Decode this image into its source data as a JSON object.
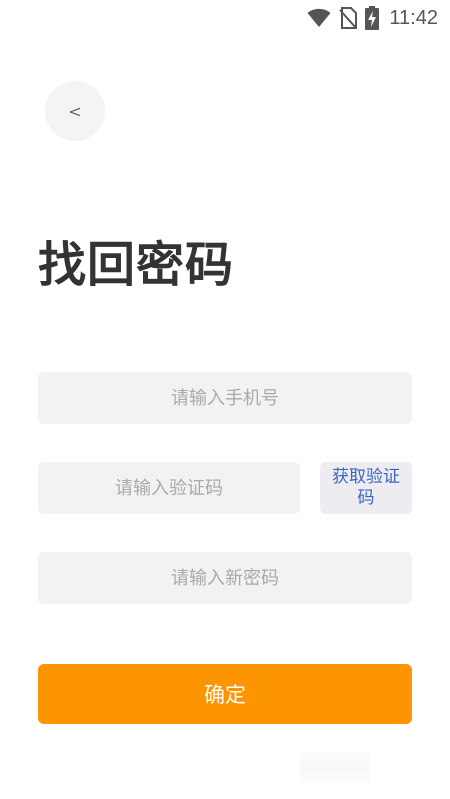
{
  "status_bar": {
    "time": "11:42",
    "icons": [
      "wifi-icon",
      "no-sim-icon",
      "battery-charging-icon"
    ]
  },
  "nav": {
    "back_label": "<"
  },
  "page": {
    "title": "找回密码"
  },
  "form": {
    "phone_placeholder": "请输入手机号",
    "code_placeholder": "请输入验证码",
    "get_code_label": "获取验证码",
    "password_placeholder": "请输入新密码",
    "confirm_label": "确定"
  },
  "colors": {
    "accent": "#fd9402",
    "link": "#3b64c6",
    "field_bg": "#f2f2f2"
  }
}
